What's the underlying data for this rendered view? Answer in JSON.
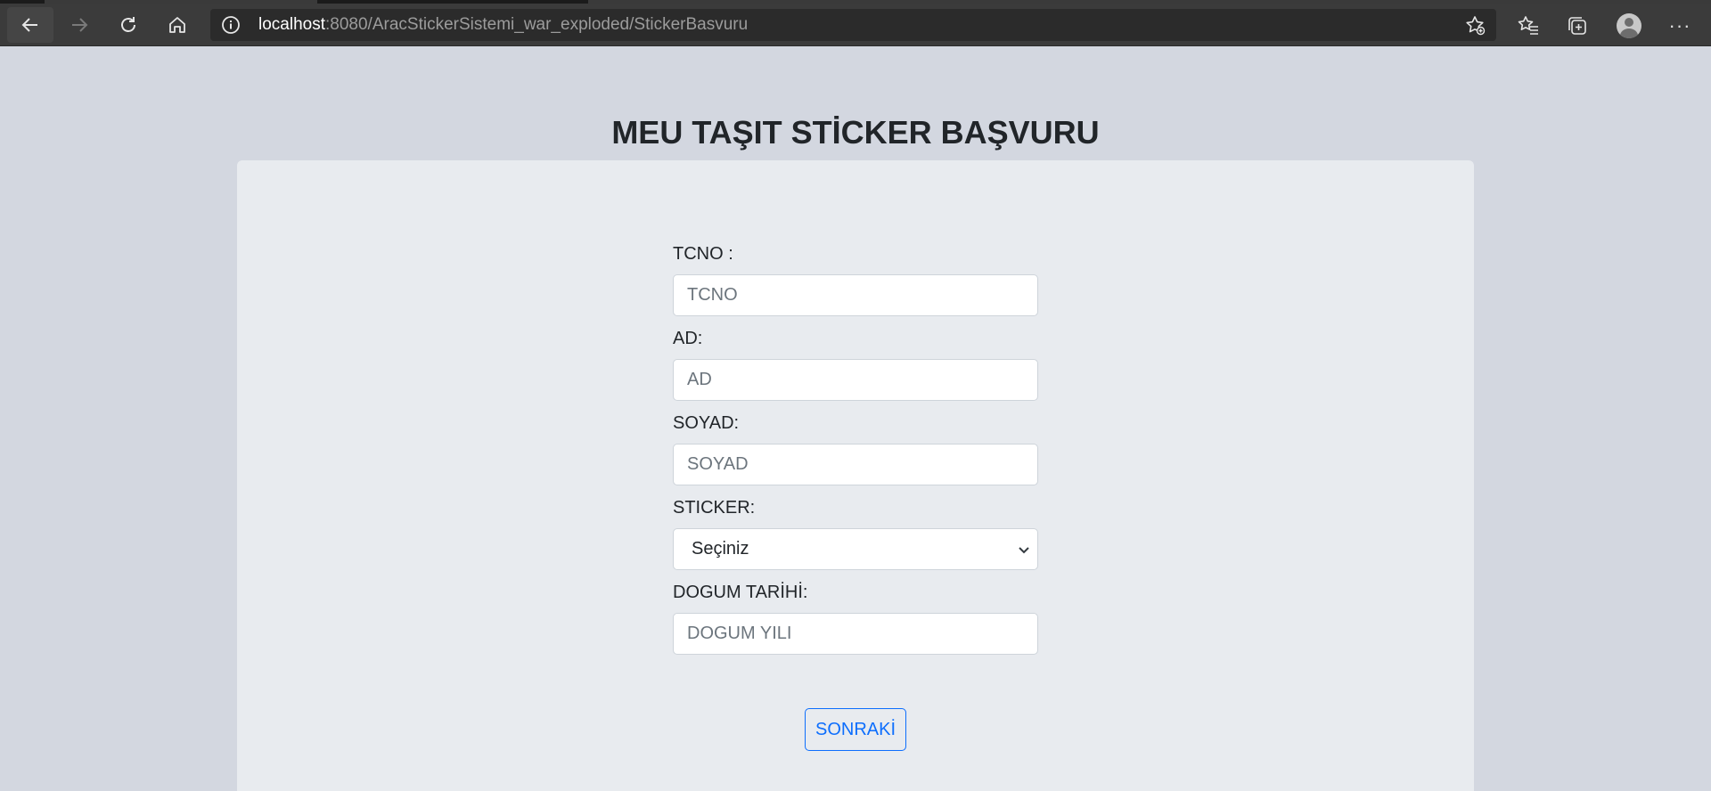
{
  "browser": {
    "url_host": "localhost",
    "url_path": ":8080/AracStickerSistemi_war_exploded/StickerBasvuru",
    "more_label": "···"
  },
  "page": {
    "title": "MEU TAŞIT STİCKER BAŞVURU"
  },
  "form": {
    "tcno": {
      "label": "TCNO :",
      "placeholder": "TCNO"
    },
    "ad": {
      "label": "AD:",
      "placeholder": "AD"
    },
    "soyad": {
      "label": "SOYAD:",
      "placeholder": "SOYAD"
    },
    "sticker": {
      "label": "STICKER:",
      "selected": "Seçiniz"
    },
    "dogum": {
      "label": "DOGUM TARİHİ:",
      "placeholder": "DOGUM YILI"
    },
    "submit_label": "SONRAKİ"
  },
  "colors": {
    "page_bg": "#d3d7e0",
    "card_bg": "#e8ebef",
    "accent": "#0d6efd",
    "toolbar_bg": "#3b3b3b"
  }
}
